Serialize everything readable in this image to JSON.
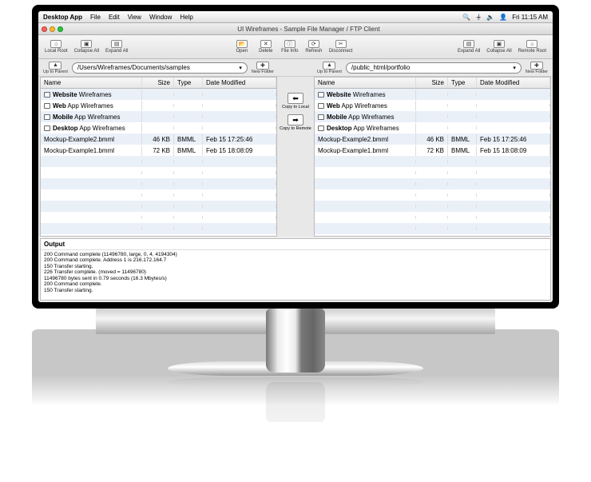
{
  "menubar": {
    "app": "Desktop App",
    "items": [
      "File",
      "Edit",
      "View",
      "Window",
      "Help"
    ],
    "clock": "Fri 11:15 AM"
  },
  "window": {
    "title": "UI Wireframes - Sample File Manager / FTP Client"
  },
  "toolbar": {
    "left": [
      {
        "name": "local-root",
        "label": "Local Root",
        "glyph": "⌂"
      },
      {
        "name": "collapse-all-l",
        "label": "Collapse All",
        "glyph": "▣"
      },
      {
        "name": "expand-all-l",
        "label": "Expand All",
        "glyph": "▤"
      }
    ],
    "center": [
      {
        "name": "open",
        "label": "Open",
        "glyph": "📂"
      },
      {
        "name": "delete",
        "label": "Delete",
        "glyph": "✕"
      },
      {
        "name": "file-info",
        "label": "File Info",
        "glyph": "ⓘ"
      },
      {
        "name": "refresh",
        "label": "Refresh",
        "glyph": "⟳"
      },
      {
        "name": "disconnect",
        "label": "Disconnect",
        "glyph": "✂"
      }
    ],
    "right": [
      {
        "name": "expand-all-r",
        "label": "Expand All",
        "glyph": "▤"
      },
      {
        "name": "collapse-all-r",
        "label": "Collapse All",
        "glyph": "▣"
      },
      {
        "name": "remote-root",
        "label": "Remote Root",
        "glyph": "⌂"
      }
    ]
  },
  "path": {
    "up_label": "Up to Parent",
    "new_folder_label": "New Folder",
    "local": "/Users/Wireframes/Documents/samples",
    "remote": "/public_html/portfolio"
  },
  "transfer": {
    "to_local": "Copy to Local",
    "to_remote": "Copy to Remote"
  },
  "columns": [
    "Name",
    "Size",
    "Type",
    "Date Modified"
  ],
  "local_rows": [
    {
      "name": "Website Wireframes",
      "folder": true
    },
    {
      "name": "Web App Wireframes",
      "folder": true
    },
    {
      "name": "Mobile App Wireframes",
      "folder": true
    },
    {
      "name": "Desktop App Wireframes",
      "folder": true
    },
    {
      "name": "Mockup-Example2.bmml",
      "size": "46 KB",
      "type": "BMML",
      "date": "Feb 15 17:25:46"
    },
    {
      "name": "Mockup-Example1.bmml",
      "size": "72 KB",
      "type": "BMML",
      "date": "Feb 15 18:08:09"
    }
  ],
  "remote_rows": [
    {
      "name": "Website Wireframes",
      "folder": true
    },
    {
      "name": "Web App Wireframes",
      "folder": true
    },
    {
      "name": "Mobile App Wireframes",
      "folder": true
    },
    {
      "name": "Desktop App Wireframes",
      "folder": true
    },
    {
      "name": "Mockup-Example2.bmml",
      "size": "46 KB",
      "type": "BMML",
      "date": "Feb 15 17:25:46"
    },
    {
      "name": "Mockup-Example1.bmml",
      "size": "72 KB",
      "type": "BMML",
      "date": "Feb 15 18:08:09"
    }
  ],
  "output": {
    "title": "Output",
    "log": "200 Command complete (11496780, large, 0, 4, 4194304)\n200 Command complete. Address 1 is 216.172.164.7\n150 Transfer starting.\n226 Transfer complete. (moved = 11496780)\n11496780 bytes sent in 0.79 seconds (16.3 Mbytes/s)\n200 Command complete.\n150 Transfer starting."
  }
}
